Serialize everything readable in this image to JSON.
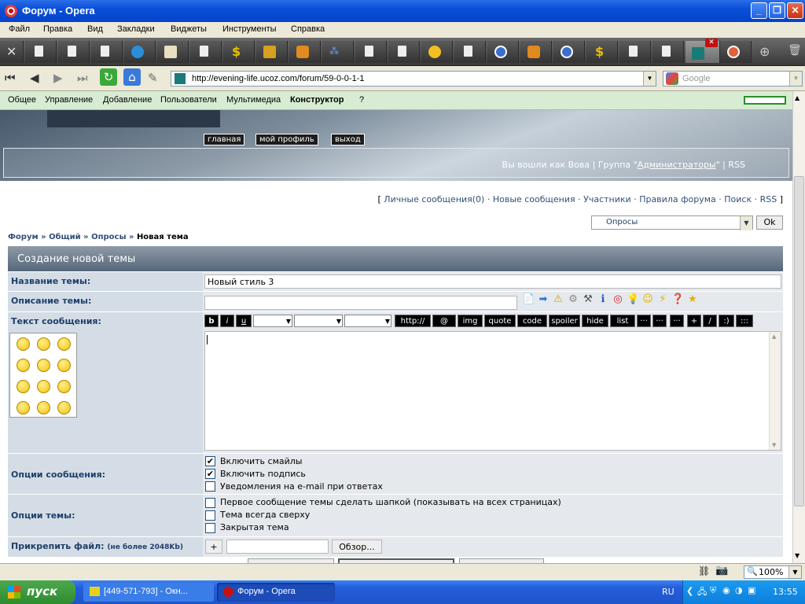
{
  "window": {
    "title": "Форум - Opera"
  },
  "menu": [
    "Файл",
    "Правка",
    "Вид",
    "Закладки",
    "Виджеты",
    "Инструменты",
    "Справка"
  ],
  "address": {
    "url": "http://evening-life.ucoz.com/forum/59-0-0-1-1",
    "search_placeholder": "Google"
  },
  "ucoz_panel": {
    "items": [
      "Общее",
      "Управление",
      "Добавление",
      "Пользователи",
      "Мультимедиа",
      "Конструктор",
      "?"
    ]
  },
  "header": {
    "buttons": [
      "главная",
      "мой профиль",
      "выход"
    ],
    "login_prefix": "Вы вошли как",
    "user": "Вова",
    "group_label": "Группа",
    "group_name": "Администраторы",
    "rss": "RSS"
  },
  "top_links": [
    "Личные сообщения(0)",
    "Новые сообщения",
    "Участники",
    "Правила форума",
    "Поиск",
    "RSS"
  ],
  "forum_select": {
    "value": "Опросы",
    "ok_label": "Ok"
  },
  "breadcrumb": [
    "Форум",
    "Общий",
    "Опросы",
    "Новая тема"
  ],
  "form": {
    "title": "Создание новой темы",
    "topic_label": "Название темы:",
    "topic_value": "Новый стиль 3",
    "desc_label": "Описание темы:",
    "text_label": "Текст сообщения:",
    "msg_options_label": "Опции сообщения:",
    "msg_options": [
      {
        "label": "Включить смайлы",
        "checked": true
      },
      {
        "label": "Включить подпись",
        "checked": true
      },
      {
        "label": "Уведомления на e-mail при ответах",
        "checked": false
      }
    ],
    "topic_options_label": "Опции темы:",
    "topic_options": [
      {
        "label": "Первое сообщение темы сделать шапкой (показывать на всех страницах)",
        "checked": false
      },
      {
        "label": "Тема всегда сверху",
        "checked": false
      },
      {
        "label": "Закрытая тема",
        "checked": false
      }
    ],
    "attach_label": "Прикрепить файл:",
    "attach_limit": "(не более 2048Kb)",
    "attach_plus": "+",
    "browse_label": "Обзор..."
  },
  "bbcodes": [
    "b",
    "i",
    "u",
    "http://",
    "@",
    "img",
    "quote",
    "code",
    "spoiler",
    "hide",
    "list",
    "···",
    "···",
    "···",
    "+",
    "/",
    ":)",
    ":::"
  ],
  "status": {
    "zoom": "100%"
  },
  "taskbar": {
    "start": "пуск",
    "tasks": [
      "[449-571-793] - Окн...",
      "Форум - Opera"
    ],
    "lang": "RU",
    "clock": "13:55"
  },
  "colors": {
    "accent": "#1d3e6b",
    "panel": "#d7ecd3",
    "form_head": "#56677a"
  }
}
